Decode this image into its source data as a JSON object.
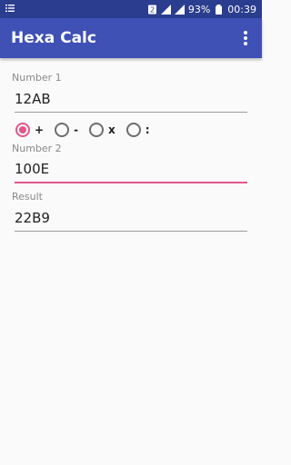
{
  "status_bar": {
    "left_icon": "notification-list-icon",
    "sim_badge": "2",
    "signal_icon": "signal-icon",
    "battery_pct": "93%",
    "time": "00:39"
  },
  "app_bar": {
    "title": "Hexa Calc",
    "menu_icon": "overflow-menu-icon"
  },
  "form": {
    "number1": {
      "label": "Number 1",
      "value": "12AB"
    },
    "operators": [
      {
        "symbol": "+",
        "checked": true
      },
      {
        "symbol": "-",
        "checked": false
      },
      {
        "symbol": "x",
        "checked": false
      },
      {
        "symbol": ":",
        "checked": false
      }
    ],
    "number2": {
      "label": "Number 2",
      "value": "100E"
    },
    "result": {
      "label": "Result",
      "value": "22B9"
    }
  },
  "colors": {
    "status_bar": "#2b3d8e",
    "app_bar": "#3f51b5",
    "accent": "#e0578a"
  }
}
